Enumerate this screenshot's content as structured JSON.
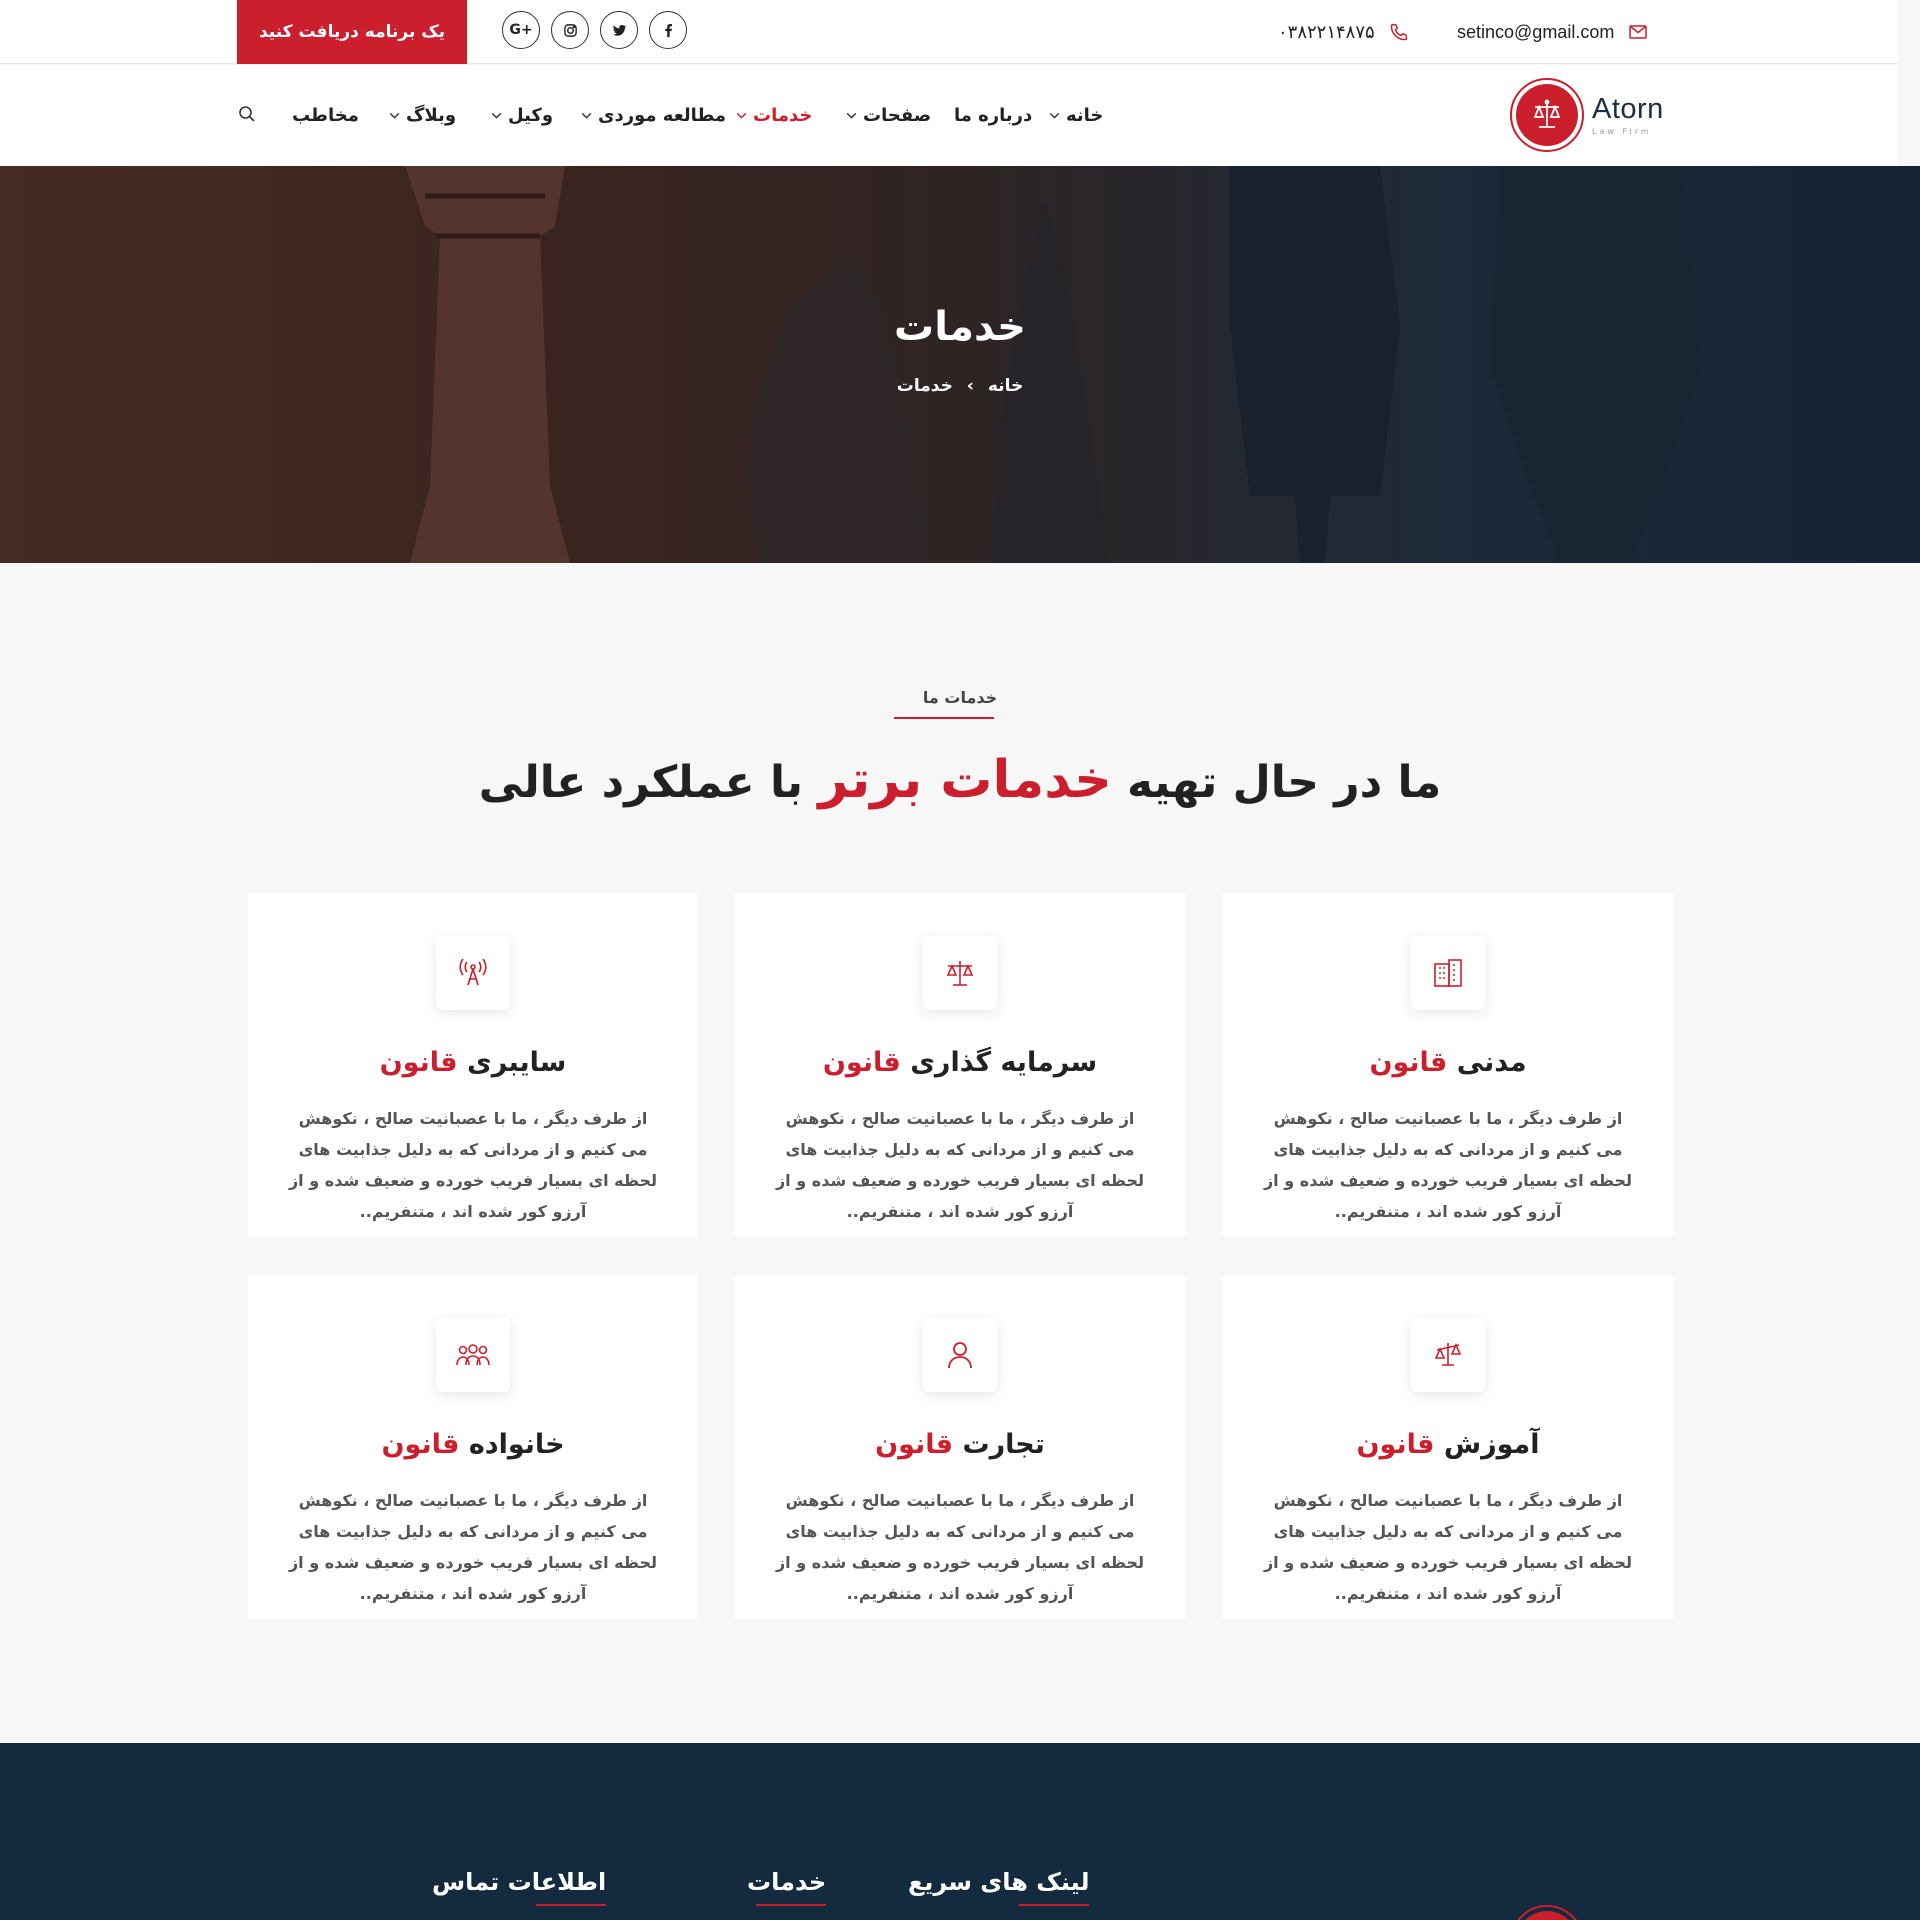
{
  "topbar": {
    "cta_label": "یک برنامه دریافت کنید",
    "phone": "۰۳۸۲۲۱۴۸۷۵",
    "email": "setinco@gmail.com",
    "social": {
      "google": "G+"
    }
  },
  "brand": {
    "name": "Atorn",
    "tagline": "Law Firm",
    "accent_color": "#cb1f2e",
    "dark_color": "#142a3e"
  },
  "nav": {
    "items": [
      {
        "label": "خانه",
        "dropdown": true,
        "active": false
      },
      {
        "label": "درباره ما",
        "dropdown": false,
        "active": false
      },
      {
        "label": "صفحات",
        "dropdown": true,
        "active": false
      },
      {
        "label": "خدمات",
        "dropdown": true,
        "active": true
      },
      {
        "label": "مطالعه موردی",
        "dropdown": true,
        "active": false
      },
      {
        "label": "وکیل",
        "dropdown": true,
        "active": false
      },
      {
        "label": "وبلاگ",
        "dropdown": true,
        "active": false
      },
      {
        "label": "مخاطب",
        "dropdown": false,
        "active": false
      }
    ]
  },
  "hero": {
    "title": "خدمات",
    "breadcrumb": {
      "home": "خانه",
      "current": "خدمات"
    }
  },
  "services": {
    "eyebrow": "خدمات ما",
    "title_pre": "ما در حال تهیه",
    "title_highlight": "خدمات برتر",
    "title_post": "با عملکرد عالی",
    "description": "از طرف دیگر ، ما با عصبانیت صالح ، نکوهش می کنیم و از مردانی که به دلیل جذابیت های لحظه ای بسیار فریب خورده و ضعیف شده و از آرزو کور شده اند ، متنفریم..",
    "cards": [
      {
        "title": "مدنی",
        "highlight": "قانون",
        "icon": "building-icon"
      },
      {
        "title": "سرمایه گذاری",
        "highlight": "قانون",
        "icon": "scales-icon"
      },
      {
        "title": "سایبری",
        "highlight": "قانون",
        "icon": "antenna-icon"
      },
      {
        "title": "آموزش",
        "highlight": "قانون",
        "icon": "scales-tilted-icon"
      },
      {
        "title": "تجارت",
        "highlight": "قانون",
        "icon": "person-icon"
      },
      {
        "title": "خانواده",
        "highlight": "قانون",
        "icon": "family-icon"
      }
    ]
  },
  "footer": {
    "col_quick_links": "لینک های سریع",
    "col_services": "خدمات",
    "col_contact": "اطلاعات تماس"
  }
}
